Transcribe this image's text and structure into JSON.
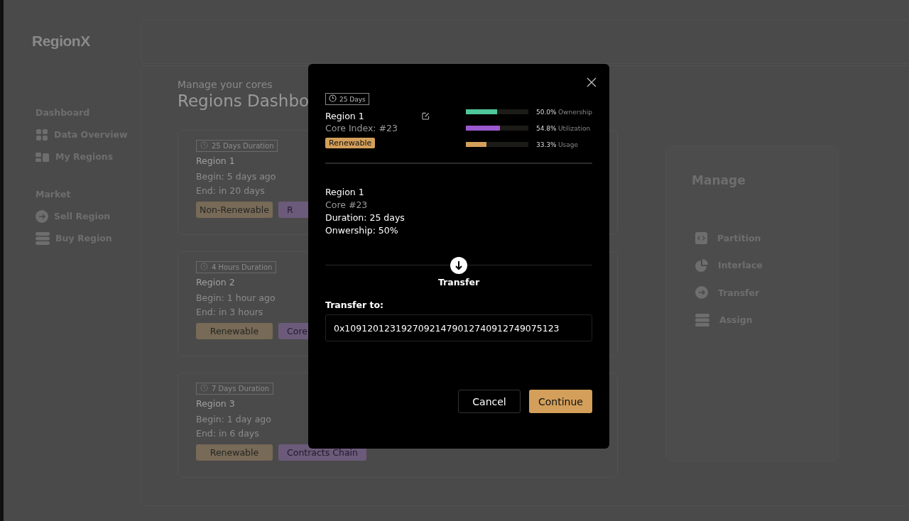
{
  "sidebar": {
    "logo": "RegionX",
    "sections": [
      {
        "title": "Dashboard",
        "items": [
          {
            "label": "Data Overview",
            "kind": "grid"
          },
          {
            "label": "My Regions",
            "kind": "blocks"
          }
        ]
      },
      {
        "title": "Market",
        "items": [
          {
            "label": "Sell Region",
            "kind": "arrow"
          },
          {
            "label": "Buy Region",
            "kind": "stack"
          }
        ]
      }
    ]
  },
  "main": {
    "subtitle": "Manage your cores",
    "title": "Regions Dashbo",
    "regions": [
      {
        "duration": "25 Days Duration",
        "name": "Region 1",
        "begin": "Begin: 5 days ago",
        "end": "End: in 20 days",
        "tags": [
          {
            "label": "Non-Renewable",
            "kind": "renewal"
          },
          {
            "label": "R",
            "kind": "chain"
          }
        ]
      },
      {
        "duration": "4 Hours Duration",
        "name": "Region 2",
        "begin": "Begin: 1 hour ago",
        "end": "End: in 3 hours",
        "tags": [
          {
            "label": "Renewable",
            "kind": "renewal"
          },
          {
            "label": "Core",
            "kind": "chain"
          }
        ]
      },
      {
        "duration": "7 Days Duration",
        "name": "Region 3",
        "begin": "Begin: 1 day ago",
        "end": "End: in 6 days",
        "tags": [
          {
            "label": "Renewable",
            "kind": "renewal"
          },
          {
            "label": "Contracts Chain",
            "kind": "chain"
          }
        ]
      }
    ]
  },
  "manage": {
    "title": "Manage",
    "actions": [
      {
        "label": "Partition",
        "kind": "code"
      },
      {
        "label": "Interlace",
        "kind": "pie"
      },
      {
        "label": "Transfer",
        "kind": "arrow"
      },
      {
        "label": "Assign",
        "kind": "stack"
      }
    ]
  },
  "modal": {
    "duration": "25 Days",
    "name": "Region 1",
    "core_index": "Core Index: #23",
    "tag": "Renewable",
    "meters": [
      {
        "reading": "50.0%",
        "label": "Ownership",
        "level": 0.5,
        "color": "#4fc79a"
      },
      {
        "reading": "54.8%",
        "label": "Utilization",
        "level": 0.548,
        "color": "#9b59d0"
      },
      {
        "reading": "33.3%",
        "label": "Usage",
        "level": 0.333,
        "color": "#d39f5a"
      }
    ],
    "summary": {
      "name": "Region 1",
      "core": "Core #23",
      "duration": "Duration: 25 days",
      "ownership": "Onwership: 50%"
    },
    "step": "Transfer",
    "field_label": "Transfer to:",
    "field_value": "0x10912012319270921479012740912749075123",
    "buttons": [
      {
        "label": "Cancel",
        "kind": "secondary"
      },
      {
        "label": "Continue",
        "kind": "primary"
      }
    ]
  }
}
